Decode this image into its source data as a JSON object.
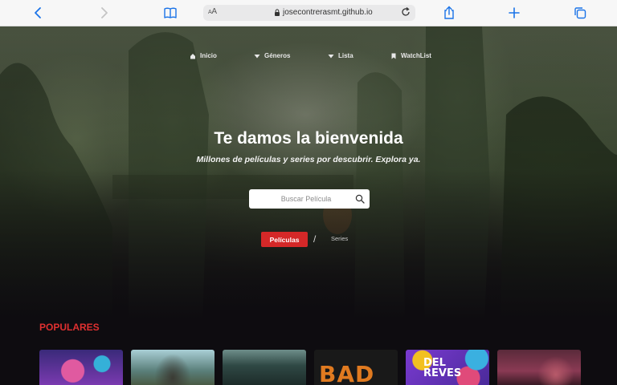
{
  "browser": {
    "text_size_label": "AA",
    "url": "josecontrerasmt.github.io"
  },
  "nav": {
    "items": [
      {
        "label": "Inicio",
        "icon": "home-icon"
      },
      {
        "label": "Géneros",
        "icon": "caret-down-icon"
      },
      {
        "label": "Lista",
        "icon": "caret-down-icon"
      },
      {
        "label": "WatchList",
        "icon": "bookmark-icon"
      }
    ]
  },
  "hero": {
    "title": "Te damos la bienvenida",
    "subtitle": "Millones de películas y series por descubrir. Explora ya."
  },
  "search": {
    "placeholder": "Buscar Película"
  },
  "toggle": {
    "movies_label": "Películas",
    "separator": "/",
    "series_label": "Series"
  },
  "popular": {
    "title": "POPULARES",
    "posters": [
      {
        "name": "poster-1",
        "bg": "#5b3a8a",
        "text": ""
      },
      {
        "name": "poster-2",
        "bg": "#4d6f6a",
        "text": ""
      },
      {
        "name": "poster-3",
        "bg": "#2f4844",
        "text": ""
      },
      {
        "name": "poster-4",
        "bg": "#191919",
        "text": "BAD"
      },
      {
        "name": "poster-5",
        "bg": "#6a3db0",
        "text": "DEL REVES"
      },
      {
        "name": "poster-6",
        "bg": "#6e2e44",
        "text": ""
      }
    ]
  },
  "colors": {
    "accent": "#d42828",
    "section_title": "#e03030"
  }
}
